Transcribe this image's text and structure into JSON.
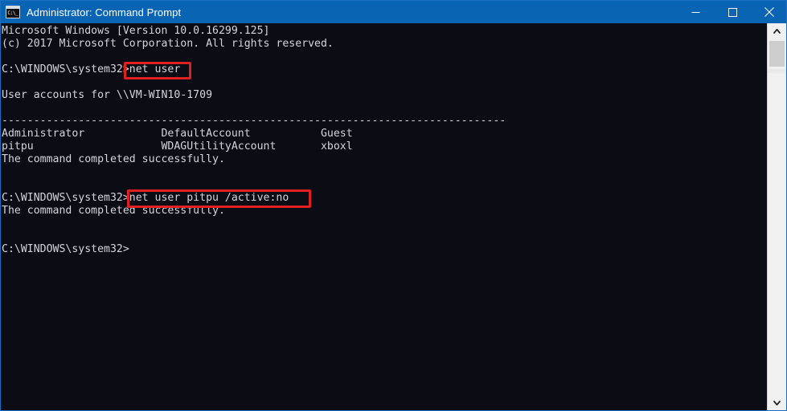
{
  "window": {
    "title": "Administrator: Command Prompt",
    "icon_name": "cmd-console-icon",
    "icon_glyph": "C:\\_",
    "titlebar_color": "#0a64b4",
    "background_color": "#0c0c14",
    "text_color": "#d2d5da",
    "annotation_color": "#e02020"
  },
  "controls": {
    "minimize_label": "Minimize",
    "maximize_label": "Maximize",
    "close_label": "Close"
  },
  "scrollbar": {
    "up_label": "Scroll up",
    "down_label": "Scroll down",
    "thumb_label": "Scroll thumb"
  },
  "console": {
    "lines": [
      "Microsoft Windows [Version 10.0.16299.125]",
      "(c) 2017 Microsoft Corporation. All rights reserved.",
      "",
      "C:\\WINDOWS\\system32>net user",
      "",
      "User accounts for \\\\VM-WIN10-1709",
      "",
      "-------------------------------------------------------------------------------",
      "Administrator            DefaultAccount           Guest",
      "pitpu                    WDAGUtilityAccount       xboxl",
      "The command completed successfully.",
      "",
      "",
      "C:\\WINDOWS\\system32>net user pitpu /active:no",
      "The command completed successfully.",
      "",
      "",
      "C:\\WINDOWS\\system32>"
    ],
    "version_line": "Microsoft Windows [Version 10.0.16299.125]",
    "copyright_line": "(c) 2017 Microsoft Corporation. All rights reserved.",
    "prompt": "C:\\WINDOWS\\system32>",
    "computer_name": "\\\\VM-WIN10-1709",
    "accounts_header": "User accounts for \\\\VM-WIN10-1709",
    "separator": "-------------------------------------------------------------------------------",
    "accounts": [
      [
        "Administrator",
        "DefaultAccount",
        "Guest"
      ],
      [
        "pitpu",
        "WDAGUtilityAccount",
        "xboxl"
      ]
    ],
    "success_message": "The command completed successfully.",
    "commands": [
      "net user",
      "net user pitpu /active:no"
    ]
  },
  "annotations": {
    "box1_target": "net user",
    "box2_target": "net user pitpu /active:no"
  }
}
